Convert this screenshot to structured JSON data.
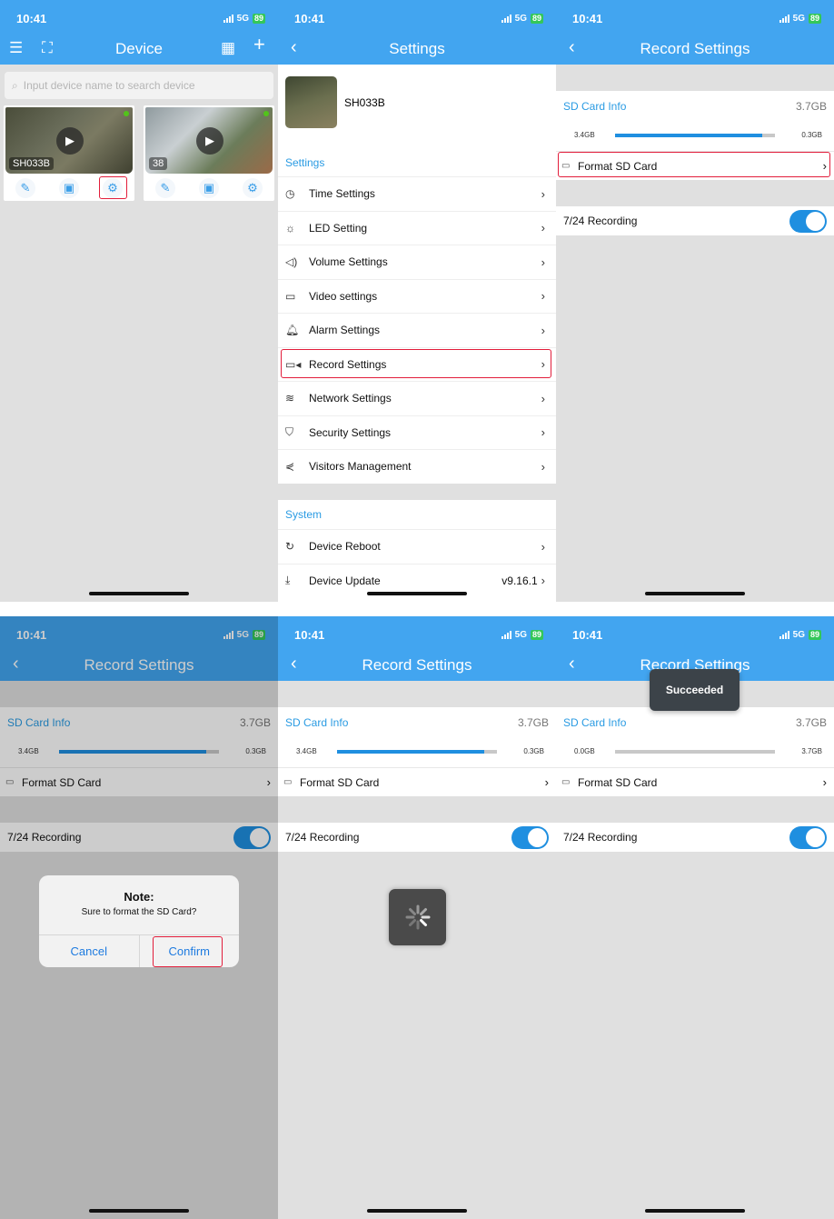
{
  "status_bar": {
    "time": "10:41",
    "network": "5G",
    "battery": "89"
  },
  "screen1": {
    "title": "Device",
    "search_placeholder": "Input device name to search device",
    "devices": [
      {
        "name": "SH033B",
        "online": true
      },
      {
        "name": "38",
        "online": true
      }
    ],
    "icons": [
      "menu-icon",
      "scan-icon",
      "grid-icon",
      "add-icon"
    ]
  },
  "screen2": {
    "title": "Settings",
    "device_name": "SH033B",
    "settings_header": "Settings",
    "settings_items": [
      {
        "label": "Time Settings",
        "icon": "clock-icon"
      },
      {
        "label": "LED Setting",
        "icon": "bulb-icon"
      },
      {
        "label": "Volume Settings",
        "icon": "volume-icon"
      },
      {
        "label": "Video settings",
        "icon": "video-icon"
      },
      {
        "label": "Alarm Settings",
        "icon": "bell-icon"
      },
      {
        "label": "Record Settings",
        "icon": "camera-icon"
      },
      {
        "label": "Network Settings",
        "icon": "wifi-icon"
      },
      {
        "label": "Security Settings",
        "icon": "shield-icon"
      },
      {
        "label": "Visitors Management",
        "icon": "share-icon"
      }
    ],
    "system_header": "System",
    "system_items": [
      {
        "label": "Device Reboot",
        "icon": "reboot-icon",
        "value": ""
      },
      {
        "label": "Device Update",
        "icon": "download-icon",
        "value": "v9.16.1"
      }
    ]
  },
  "record": {
    "title": "Record Settings",
    "sd_card_info": "SD Card Info",
    "capacity": "3.7GB",
    "format_label": "Format SD Card",
    "recording_label": "7/24 Recording",
    "recording_on": true,
    "before": {
      "used": "3.4GB",
      "free": "0.3GB",
      "used_fraction": 0.92
    },
    "after": {
      "used": "0.0GB",
      "free": "3.7GB",
      "used_fraction": 0.0
    }
  },
  "dialog": {
    "title": "Note:",
    "message": "Sure to format the SD Card?",
    "cancel": "Cancel",
    "confirm": "Confirm"
  },
  "toast": {
    "message": "Succeeded"
  },
  "colors": {
    "header": "#42a5f0",
    "accent": "#2a9be3",
    "highlight": "#e21d3b",
    "toggle": "#1f8fe0"
  }
}
